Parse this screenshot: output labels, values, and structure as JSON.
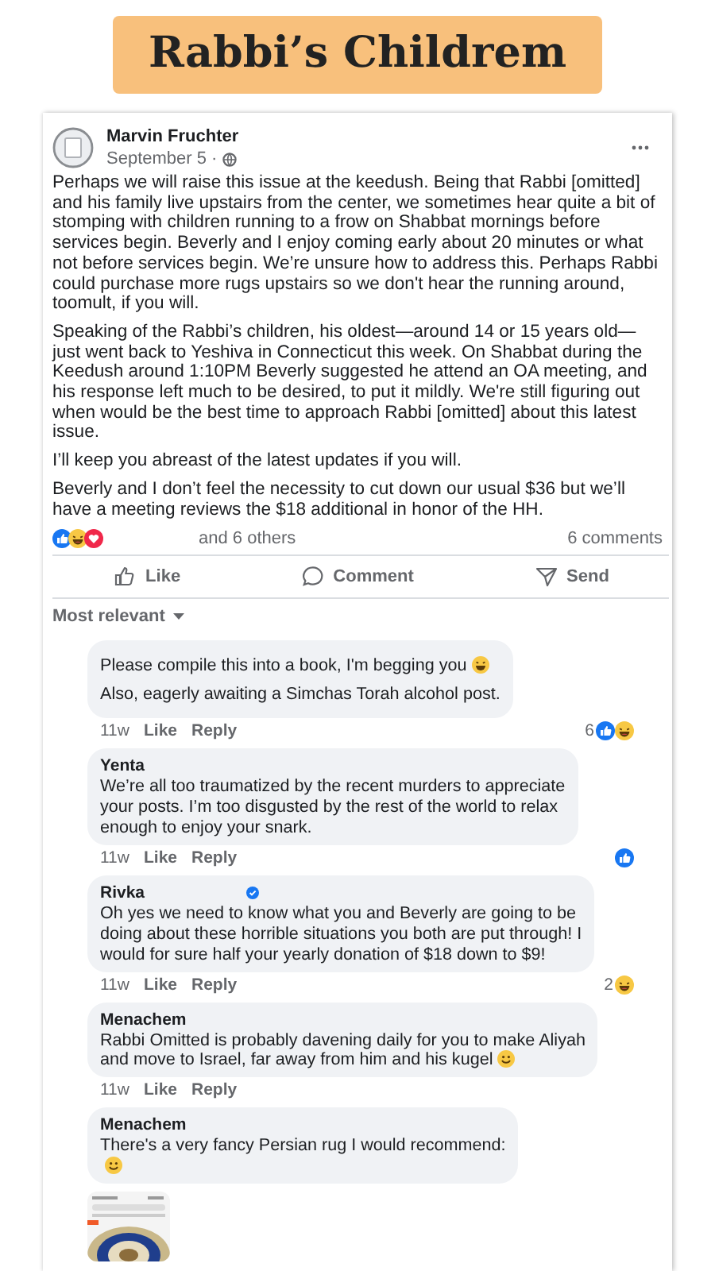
{
  "banner": {
    "title": "Rabbi’s Childrem"
  },
  "post": {
    "author": "Marvin Fruchter",
    "date": "September 5 ·",
    "paragraphs": [
      "Perhaps we will raise this issue at the keedush. Being that Rabbi [omitted] and his family live upstairs from the center, we sometimes hear quite a bit of stomping with children running to a frow on Shabbat mornings before services begin. Beverly and I enjoy coming early about 20 minutes or what not before services begin. We’re unsure how to address this. Perhaps Rabbi could purchase more rugs upstairs so we don't hear the running around, toomult, if you will.",
      "Speaking of the Rabbi’s children, his oldest—around 14 or 15 years old—just went back to Yeshiva in Connecticut this week. On Shabbat during the Keedush around 1:10PM Beverly suggested he attend an OA meeting, and his response left much to be desired, to put it mildly. We're still figuring out when would be the best time to approach Rabbi [omitted] about this latest issue.",
      "I’ll keep you abreast of the latest updates if you will.",
      "Beverly and I don’t feel the necessity to cut down our usual $36 but we’ll have a meeting reviews the $18 additional in honor of the HH."
    ],
    "reactions": [
      {
        "kind": "like"
      },
      {
        "kind": "haha"
      },
      {
        "kind": "love"
      }
    ],
    "reactions_summary": "and 6 others",
    "comments_count": "6 comments",
    "actions": [
      {
        "kind": "like",
        "label": "Like"
      },
      {
        "kind": "comment",
        "label": "Comment"
      },
      {
        "kind": "send",
        "label": "Send"
      }
    ]
  },
  "sort": {
    "label": "Most relevant"
  },
  "comments": [
    {
      "lines": [
        {
          "text": "Please compile this into a book, I'm begging you",
          "emoji": {
            "kind": "laugh"
          }
        },
        {
          "text": "Also, eagerly awaiting a Simchas Torah alcohol post."
        }
      ],
      "time": "11w",
      "actions": [
        "Like",
        "Reply"
      ],
      "reaction_count": "6",
      "reactions": [
        {
          "kind": "like"
        },
        {
          "kind": "haha"
        }
      ]
    },
    {
      "author": "Yenta",
      "verified": false,
      "lines": [
        {
          "text": "We’re all too traumatized by the recent murders to appreciate"
        },
        {
          "text": "your posts. I’m too disgusted by the rest of the world to relax"
        },
        {
          "text": "enough to enjoy your snark."
        }
      ],
      "time": "11w",
      "actions": [
        "Like",
        "Reply"
      ],
      "reactions": [
        {
          "kind": "like"
        }
      ]
    },
    {
      "author": "Rivka",
      "verified": true,
      "lines": [
        {
          "text": "Oh yes we need to know what you and Beverly are going to be"
        },
        {
          "text": "doing about these horrible situations you both are put through! I"
        },
        {
          "text": "would for sure half your yearly donation of $18 down to $9!"
        }
      ],
      "time": "11w",
      "actions": [
        "Like",
        "Reply"
      ],
      "reaction_count": "2",
      "reactions": [
        {
          "kind": "haha"
        }
      ]
    },
    {
      "author": "Menachem",
      "verified": false,
      "lines": [
        {
          "text": "Rabbi Omitted is probably davening daily for you to make Aliyah"
        },
        {
          "text": "and move to Israel, far away from him and his kugel",
          "emoji": {
            "kind": "smile"
          }
        }
      ],
      "time": "11w",
      "actions": [
        "Like",
        "Reply"
      ]
    },
    {
      "author": "Menachem",
      "verified": false,
      "lines": [
        {
          "text": "There's a very fancy Persian rug I would recommend:"
        },
        {
          "emoji": {
            "kind": "smile"
          }
        }
      ],
      "attachment": {
        "kind": "picture"
      }
    }
  ]
}
